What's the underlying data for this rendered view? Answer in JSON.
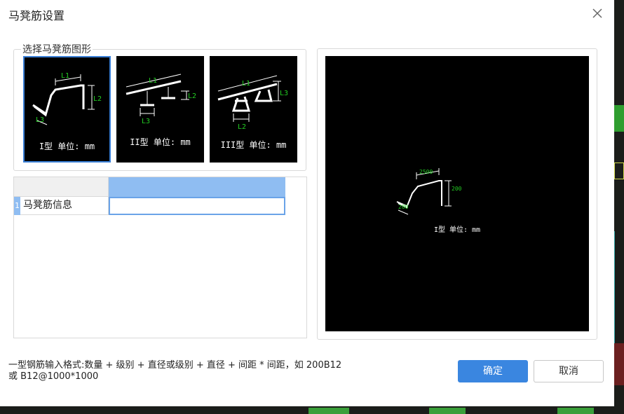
{
  "dialog": {
    "title": "马凳筋设置"
  },
  "shape_group": {
    "legend": "选择马凳筋图形",
    "options": [
      {
        "label": "I型 单位: mm",
        "dims": [
          "L1",
          "L2",
          "L3"
        ],
        "selected": true
      },
      {
        "label": "II型 单位: mm",
        "dims": [
          "L1",
          "L2",
          "L3"
        ],
        "selected": false
      },
      {
        "label": "III型 单位: mm",
        "dims": [
          "L1",
          "L2",
          "L3"
        ],
        "selected": false
      }
    ]
  },
  "grid": {
    "rows": [
      {
        "number": "1",
        "label": "马凳筋信息",
        "value": ""
      }
    ]
  },
  "preview": {
    "label": "I型 单位: mm",
    "dims": {
      "L1": "2500",
      "L2": "200",
      "L3": "200"
    }
  },
  "hint": {
    "line1": "一型钢筋输入格式:数量 + 级别 + 直径或级别 + 直径 + 间距 * 间距，如 200B12",
    "line2": "或 B12@1000*1000"
  },
  "buttons": {
    "ok": "确定",
    "cancel": "取消"
  },
  "colors": {
    "accent": "#3a86e0",
    "selection_border": "#3a7fd6",
    "dimension_text": "#22cc22",
    "grid_header": "#8fbdf2"
  }
}
